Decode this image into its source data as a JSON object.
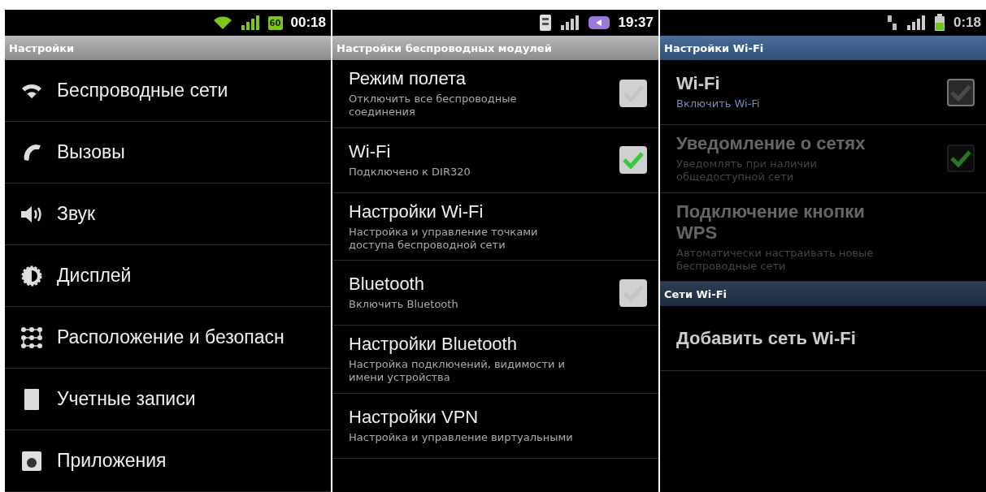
{
  "panels": [
    {
      "kind": "stock",
      "status_bar": {
        "battery_label": "60",
        "time": "00:18"
      },
      "header": "Настройки",
      "items": [
        {
          "kind": "icon",
          "title": "Беспроводные сети"
        },
        {
          "kind": "icon",
          "title": "Вызовы"
        },
        {
          "kind": "icon",
          "title": "Звук"
        },
        {
          "kind": "icon",
          "title": "Дисплей"
        },
        {
          "kind": "icon",
          "title": "Расположение и безопасн"
        },
        {
          "kind": "icon",
          "title": "Учетные записи"
        },
        {
          "kind": "icon",
          "title": "Приложения"
        }
      ]
    },
    {
      "kind": "stock",
      "status_bar": {
        "time": "19:37"
      },
      "header": "Настройки беспроводных модулей",
      "items": [
        {
          "kind": "checkbox",
          "title": "Режим полета",
          "subtitle": "Отключить все беспроводные соединения",
          "checked": false,
          "disabled": false
        },
        {
          "kind": "checkbox",
          "title": "Wi-Fi",
          "subtitle": "Подключено к DIR320",
          "checked": true,
          "disabled": false
        },
        {
          "kind": "text",
          "title": "Настройки Wi-Fi",
          "subtitle": "Настройка и управление точками доступа беспроводной сети",
          "disabled": false
        },
        {
          "kind": "checkbox",
          "title": "Bluetooth",
          "subtitle": "Включить Bluetooth",
          "checked": false,
          "disabled": false
        },
        {
          "kind": "text",
          "title": "Настройки Bluetooth",
          "subtitle": "Настройка подключений, видимости и имени устройства",
          "disabled": false
        },
        {
          "kind": "text",
          "title": "Настройки VPN",
          "subtitle": "Настройка и управление виртуальными",
          "disabled": false
        }
      ]
    },
    {
      "kind": "samsung",
      "status_bar": {
        "time": "0:18"
      },
      "header": "Настройки Wi-Fi",
      "items": [
        {
          "kind": "checkbox",
          "title": "Wi-Fi",
          "subtitle": "Включить Wi-Fi",
          "checked": false,
          "disabled": false
        },
        {
          "kind": "checkbox",
          "title": "Уведомление о сетях",
          "subtitle": "Уведомлять при наличии общедоступной сети",
          "checked": true,
          "disabled": true
        },
        {
          "kind": "text",
          "title": "Подключение кнопки WPS",
          "subtitle": "Автоматически настраивать новые беспроводные сети",
          "disabled": true
        },
        {
          "kind": "section",
          "title": "Сети Wi-Fi"
        },
        {
          "kind": "text",
          "title": "Добавить сеть Wi-Fi",
          "disabled": false
        }
      ]
    }
  ]
}
